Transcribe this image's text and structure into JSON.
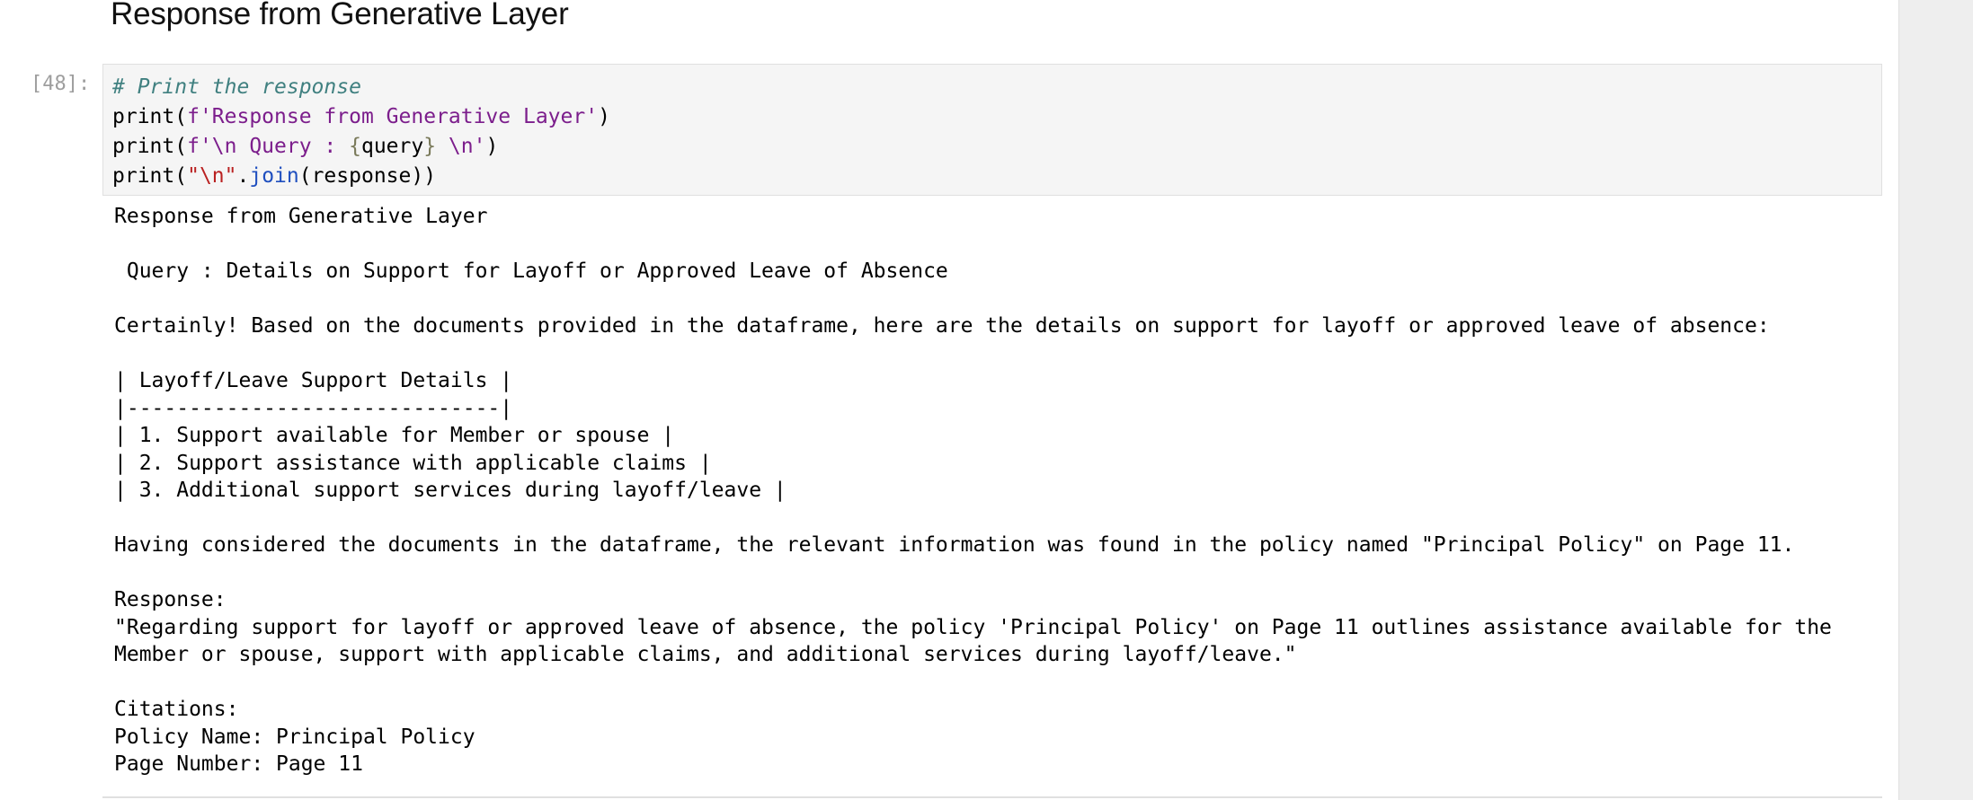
{
  "cell": {
    "heading": "Response from Generative Layer",
    "prompt": "[48]:",
    "code": {
      "line1_comment": "# Print the response",
      "line2": {
        "call": "print(",
        "fstring": "f'Response from Generative Layer'",
        "close": ")"
      },
      "line3": {
        "call": "print(",
        "fstring_start": "f'\\n Query : ",
        "brace_open": "{",
        "var": "query",
        "brace_close": "}",
        "fstring_end": " \\n'",
        "close": ")"
      },
      "line4": {
        "call": "print(",
        "str": "\"\\n\"",
        "dot": ".",
        "method": "join",
        "rest": "(response))"
      }
    },
    "output": "Response from Generative Layer\n\n Query : Details on Support for Layoff or Approved Leave of Absence\n\nCertainly! Based on the documents provided in the dataframe, here are the details on support for layoff or approved leave of absence:\n\n| Layoff/Leave Support Details |\n|------------------------------|\n| 1. Support available for Member or spouse |\n| 2. Support assistance with applicable claims |\n| 3. Additional support services during layoff/leave |\n\nHaving considered the documents in the dataframe, the relevant information was found in the policy named \"Principal Policy\" on Page 11.\n\nResponse:\n\"Regarding support for layoff or approved leave of absence, the policy 'Principal Policy' on Page 11 outlines assistance available for the\nMember or spouse, support with applicable claims, and additional services during layoff/leave.\"\n\nCitations:\nPolicy Name: Principal Policy\nPage Number: Page 11"
  }
}
